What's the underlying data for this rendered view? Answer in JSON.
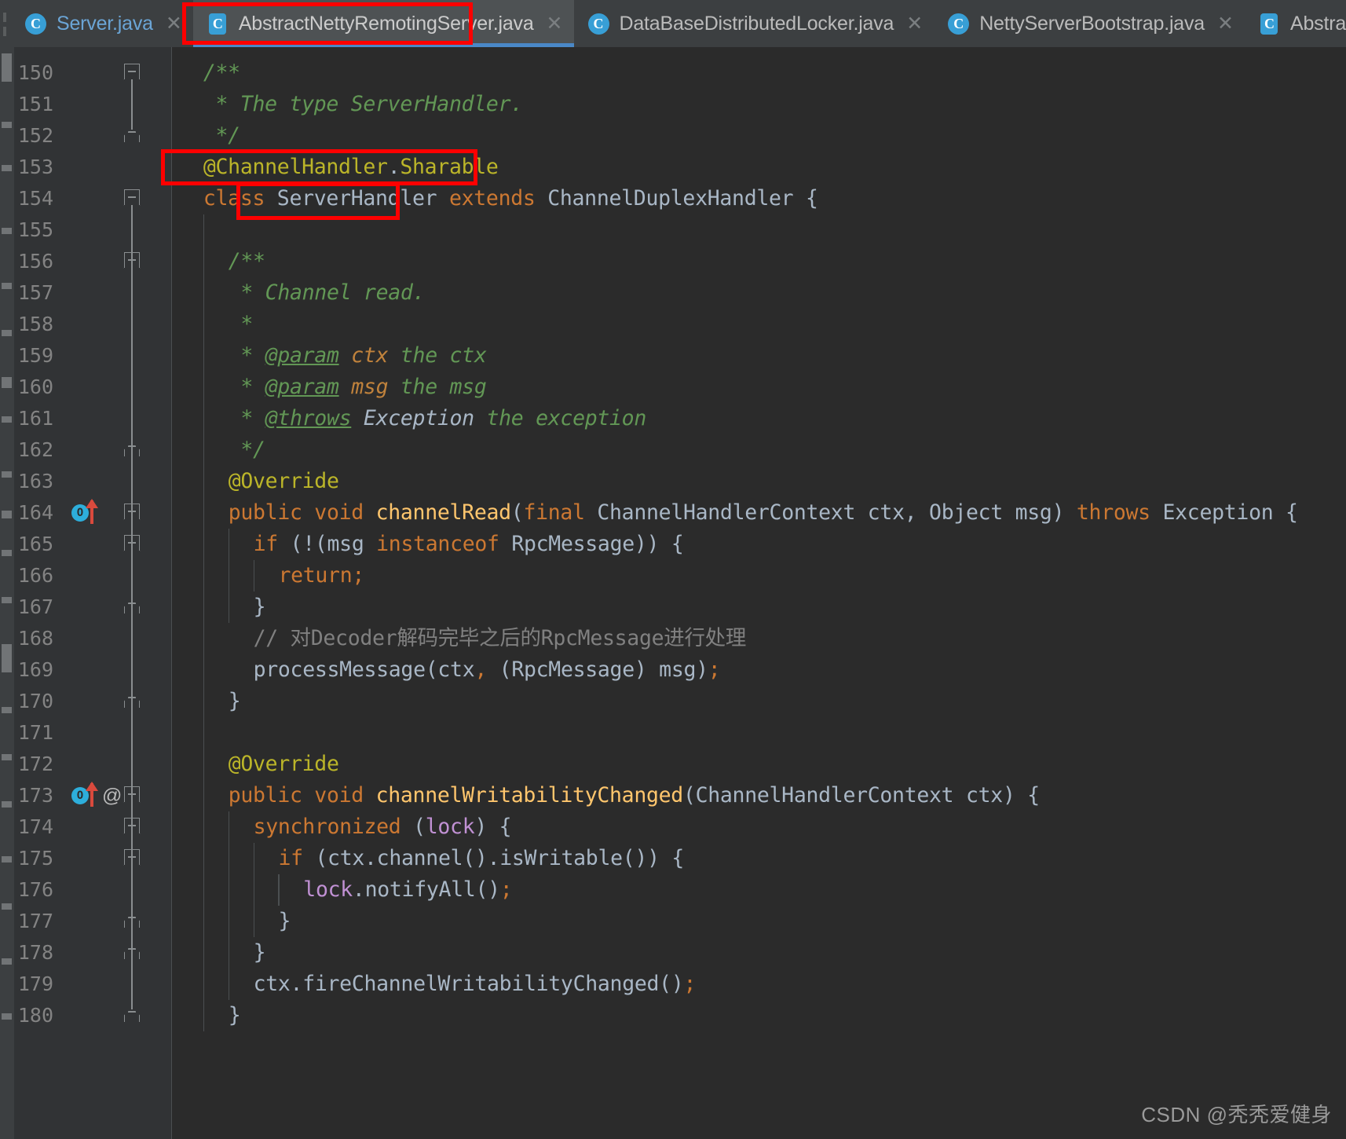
{
  "window": {
    "app": "IntelliJ IDEA",
    "theme": "Darcula",
    "colors": {
      "editor_bg": "#2B2B2B",
      "gutter_bg": "#313335",
      "tabbar_bg": "#3C3F41",
      "tab_active_bg": "#4E5254",
      "tab_underline": "#4A88C7",
      "annotation_red": "#FF0000",
      "keyword": "#CC7832",
      "method": "#FFC66D",
      "annotation_yellow": "#BBB529",
      "comment_green": "#629755",
      "comment_gray": "#808080",
      "field_purple": "#C191D4",
      "text": "#A9B7C6",
      "line_number": "#838383"
    }
  },
  "tabs": [
    {
      "label": "Server.java",
      "icon": "java-class-icon",
      "active": false,
      "closable": true,
      "modified_color": "#6BA5D6"
    },
    {
      "label": "AbstractNettyRemotingServer.java",
      "icon": "java-class-icon",
      "active": true,
      "closable": true
    },
    {
      "label": "DataBaseDistributedLocker.java",
      "icon": "java-class-icon",
      "active": false,
      "closable": true
    },
    {
      "label": "NettyServerBootstrap.java",
      "icon": "java-class-icon",
      "active": false,
      "closable": true
    },
    {
      "label": "AbstractNettyRem",
      "icon": "java-class-icon",
      "active": false,
      "closable": false,
      "truncated": true
    }
  ],
  "editor": {
    "first_visible_line": 150,
    "last_visible_line": 180,
    "lines": [
      {
        "n": 150,
        "indent": 1,
        "segments": [
          {
            "t": "/**",
            "c": "cmt"
          }
        ]
      },
      {
        "n": 151,
        "indent": 1,
        "segments": [
          {
            "t": " * The type ServerHandler.",
            "c": "cmt"
          }
        ]
      },
      {
        "n": 152,
        "indent": 1,
        "segments": [
          {
            "t": " */",
            "c": "cmt"
          }
        ]
      },
      {
        "n": 153,
        "indent": 1,
        "segments": [
          {
            "t": "@ChannelHandler",
            "c": "ann"
          },
          {
            "t": ".",
            "c": "txt"
          },
          {
            "t": "Sharable",
            "c": "ann"
          }
        ]
      },
      {
        "n": 154,
        "indent": 1,
        "segments": [
          {
            "t": "class ",
            "c": "kw"
          },
          {
            "t": "ServerHandler ",
            "c": "txt"
          },
          {
            "t": "extends ",
            "c": "kw"
          },
          {
            "t": "ChannelDuplexHandler {",
            "c": "txt"
          }
        ]
      },
      {
        "n": 155,
        "indent": 1,
        "segments": []
      },
      {
        "n": 156,
        "indent": 2,
        "segments": [
          {
            "t": "/**",
            "c": "cmt"
          }
        ]
      },
      {
        "n": 157,
        "indent": 2,
        "segments": [
          {
            "t": " * Channel read.",
            "c": "cmt"
          }
        ]
      },
      {
        "n": 158,
        "indent": 2,
        "segments": [
          {
            "t": " *",
            "c": "cmt"
          }
        ]
      },
      {
        "n": 159,
        "indent": 2,
        "segments": [
          {
            "t": " * ",
            "c": "cmt"
          },
          {
            "t": "@param",
            "c": "jtag"
          },
          {
            "t": " ctx",
            "c": "jpar"
          },
          {
            "t": " the ctx",
            "c": "cmt"
          }
        ]
      },
      {
        "n": 160,
        "indent": 2,
        "segments": [
          {
            "t": " * ",
            "c": "cmt"
          },
          {
            "t": "@param",
            "c": "jtag"
          },
          {
            "t": " msg",
            "c": "jpar"
          },
          {
            "t": " the msg",
            "c": "cmt"
          }
        ]
      },
      {
        "n": 161,
        "indent": 2,
        "segments": [
          {
            "t": " * ",
            "c": "cmt"
          },
          {
            "t": "@throws",
            "c": "jtag"
          },
          {
            "t": " Exception",
            "c": "jcls"
          },
          {
            "t": " the exception",
            "c": "cmt"
          }
        ]
      },
      {
        "n": 162,
        "indent": 2,
        "segments": [
          {
            "t": " */",
            "c": "cmt"
          }
        ]
      },
      {
        "n": 163,
        "indent": 2,
        "segments": [
          {
            "t": "@Override",
            "c": "ann"
          }
        ]
      },
      {
        "n": 164,
        "indent": 2,
        "gutter": "override-marker",
        "segments": [
          {
            "t": "public void ",
            "c": "kw"
          },
          {
            "t": "channelRead",
            "c": "mth"
          },
          {
            "t": "(",
            "c": "txt"
          },
          {
            "t": "final ",
            "c": "kw"
          },
          {
            "t": "ChannelHandlerContext ctx, Object msg) ",
            "c": "txt"
          },
          {
            "t": "throws ",
            "c": "kw"
          },
          {
            "t": "Exception {",
            "c": "txt"
          }
        ]
      },
      {
        "n": 165,
        "indent": 3,
        "segments": [
          {
            "t": "if ",
            "c": "kw"
          },
          {
            "t": "(!(msg ",
            "c": "txt"
          },
          {
            "t": "instanceof ",
            "c": "kw"
          },
          {
            "t": "RpcMessage)) {",
            "c": "txt"
          }
        ]
      },
      {
        "n": 166,
        "indent": 4,
        "segments": [
          {
            "t": "return",
            "c": "kw"
          },
          {
            "t": ";",
            "c": "sem"
          }
        ]
      },
      {
        "n": 167,
        "indent": 3,
        "segments": [
          {
            "t": "}",
            "c": "txt"
          }
        ]
      },
      {
        "n": 168,
        "indent": 3,
        "segments": [
          {
            "t": "// 对Decoder解码完毕之后的RpcMessage进行处理",
            "c": "cmtn"
          }
        ]
      },
      {
        "n": 169,
        "indent": 3,
        "segments": [
          {
            "t": "processMessage(ctx",
            "c": "txt"
          },
          {
            "t": ",",
            "c": "sem"
          },
          {
            "t": " (RpcMessage) msg)",
            "c": "txt"
          },
          {
            "t": ";",
            "c": "sem"
          }
        ]
      },
      {
        "n": 170,
        "indent": 2,
        "segments": [
          {
            "t": "}",
            "c": "txt"
          }
        ]
      },
      {
        "n": 171,
        "indent": 2,
        "segments": []
      },
      {
        "n": 172,
        "indent": 2,
        "segments": [
          {
            "t": "@Override",
            "c": "ann"
          }
        ]
      },
      {
        "n": 173,
        "indent": 2,
        "gutter": "override-marker-annotated",
        "segments": [
          {
            "t": "public void ",
            "c": "kw"
          },
          {
            "t": "channelWritabilityChanged",
            "c": "mth"
          },
          {
            "t": "(ChannelHandlerContext ctx) {",
            "c": "txt"
          }
        ]
      },
      {
        "n": 174,
        "indent": 3,
        "segments": [
          {
            "t": "synchronized ",
            "c": "kw"
          },
          {
            "t": "(",
            "c": "txt"
          },
          {
            "t": "lock",
            "c": "fld"
          },
          {
            "t": ") {",
            "c": "txt"
          }
        ]
      },
      {
        "n": 175,
        "indent": 4,
        "segments": [
          {
            "t": "if ",
            "c": "kw"
          },
          {
            "t": "(ctx.channel().isWritable()) {",
            "c": "txt"
          }
        ]
      },
      {
        "n": 176,
        "indent": 5,
        "segments": [
          {
            "t": "lock",
            "c": "fld"
          },
          {
            "t": ".notifyAll()",
            "c": "txt"
          },
          {
            "t": ";",
            "c": "sem"
          }
        ]
      },
      {
        "n": 177,
        "indent": 4,
        "segments": [
          {
            "t": "}",
            "c": "txt"
          }
        ]
      },
      {
        "n": 178,
        "indent": 3,
        "segments": [
          {
            "t": "}",
            "c": "txt"
          }
        ]
      },
      {
        "n": 179,
        "indent": 3,
        "segments": [
          {
            "t": "ctx.fireChannelWritabilityChanged()",
            "c": "txt"
          },
          {
            "t": ";",
            "c": "sem"
          }
        ]
      },
      {
        "n": 180,
        "indent": 2,
        "segments": [
          {
            "t": "}",
            "c": "txt"
          }
        ]
      }
    ]
  },
  "annotations": [
    {
      "name": "highlight-tab",
      "target": "AbstractNettyRemotingServer.java tab"
    },
    {
      "name": "highlight-sharable-annotation",
      "target": "@ChannelHandler.Sharable"
    },
    {
      "name": "highlight-serverhandler-classname",
      "target": "ServerHandler"
    }
  ],
  "watermark": {
    "text": "CSDN @秃秃爱健身"
  }
}
